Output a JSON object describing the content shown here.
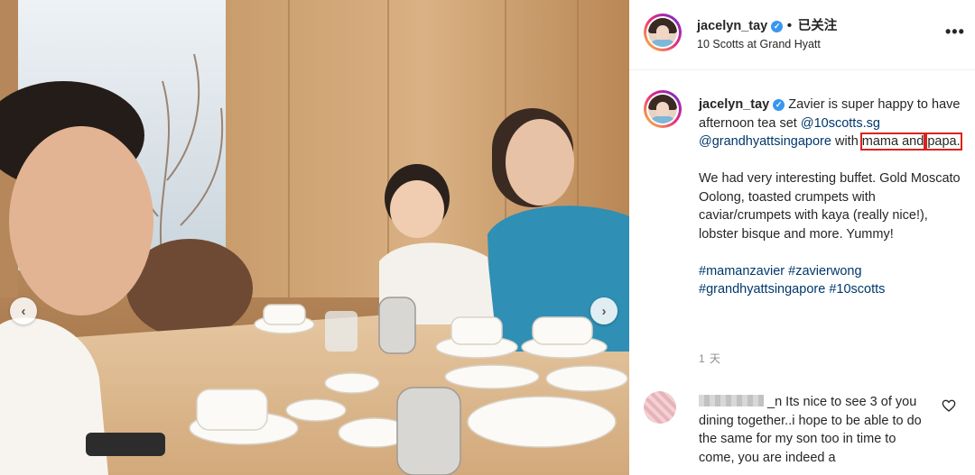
{
  "post": {
    "username": "jacelyn_tay",
    "follow_status": "已关注",
    "location": "10 Scotts at Grand Hyatt",
    "more_glyph": "•••"
  },
  "caption": {
    "username": "jacelyn_tay",
    "text_1": " Zavier is super happy to have afternoon tea set ",
    "mention_1": "@10scotts.sg",
    "mention_2": "@grandhyattsingapore",
    "text_2": " with ",
    "highlight_1": "mama and",
    "highlight_2": "papa.",
    "paragraph_2": "We had very interesting buffet. Gold Moscato Oolong, toasted crumpets with caviar/crumpets with kaya (really nice!), lobster bisque and more. Yummy!",
    "hashtags": [
      "#mamanzavier",
      "#zavierwong",
      "#grandhyattsingapore",
      "#10scotts"
    ],
    "timestamp": "1 天"
  },
  "comment": {
    "username_tail": "_n",
    "text": "Its nice to see 3 of you dining together..i hope to be able to do the same for my son too in time to come, you are indeed a"
  },
  "carousel": {
    "prev_glyph": "‹",
    "next_glyph": "›"
  },
  "icons": {
    "verified": "verified-badge-icon",
    "heart": "heart-outline-icon",
    "more": "more-options-icon",
    "prev": "chevron-left-icon",
    "next": "chevron-right-icon"
  },
  "colors": {
    "link": "#00376b",
    "verified": "#3897f0",
    "highlight_box": "#d9241c",
    "muted": "#8e8e8e"
  }
}
